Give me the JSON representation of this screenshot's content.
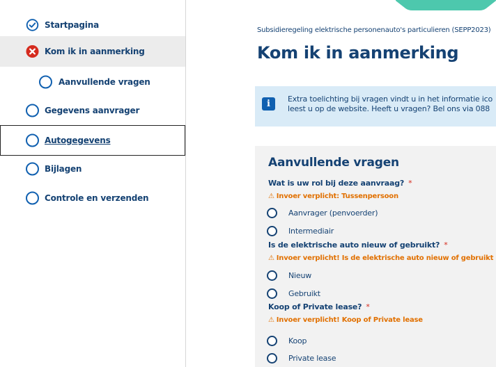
{
  "sidebar": {
    "items": [
      {
        "label": "Startpagina",
        "status": "completed"
      },
      {
        "label": "Kom ik in aanmerking",
        "status": "error"
      },
      {
        "label": "Aanvullende vragen",
        "status": "open"
      },
      {
        "label": "Gegevens aanvrager",
        "status": "open"
      },
      {
        "label": "Autogegevens",
        "status": "open"
      },
      {
        "label": "Bijlagen",
        "status": "open"
      },
      {
        "label": "Controle en verzenden",
        "status": "open"
      }
    ]
  },
  "main": {
    "breadcrumb": "Subsidieregeling elektrische personenauto's particulieren (SEPP2023)",
    "title": "Kom ik in aanmerking",
    "info": {
      "line1": "Extra toelichting bij vragen vindt u in het informatie ico",
      "line2": "leest u op de website. Heeft u vragen? Bel ons via 088"
    },
    "form": {
      "title": "Aanvullende vragen",
      "questions": [
        {
          "label": "Wat is uw rol bij deze aanvraag?",
          "required_mark": "*",
          "error": "Invoer verplicht: Tussenpersoon",
          "options": [
            "Aanvrager (penvoerder)",
            "Intermediair"
          ]
        },
        {
          "label": "Is de elektrische auto nieuw of gebruikt?",
          "required_mark": "*",
          "error": "Invoer verplicht! Is de elektrische auto nieuw of gebruikt",
          "options": [
            "Nieuw",
            "Gebruikt"
          ]
        },
        {
          "label": "Koop of Private lease?",
          "required_mark": "*",
          "error": "Invoer verplicht! Koop of Private lease",
          "options": [
            "Koop",
            "Private lease"
          ]
        }
      ]
    }
  },
  "colors": {
    "text_primary": "#154273",
    "accent_blue": "#1060b0",
    "error_red": "#d52b1e",
    "warning_orange": "#e17000",
    "info_bg": "#d9ebf7",
    "form_bg": "#f2f2f2",
    "top_tab": "#4dc8ad"
  }
}
